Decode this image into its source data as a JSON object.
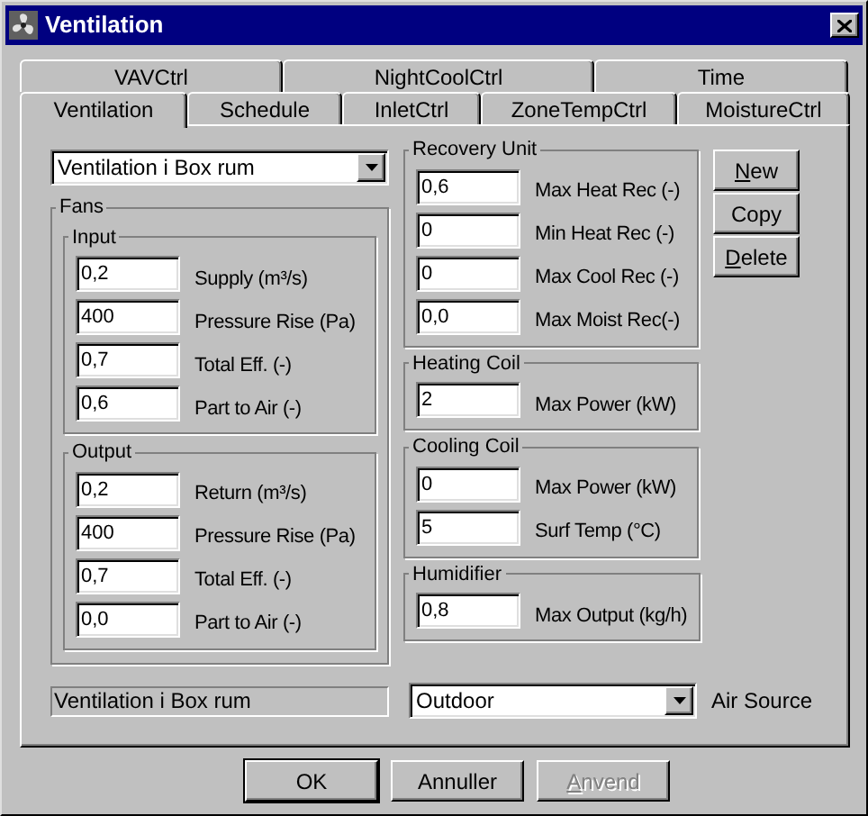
{
  "window": {
    "title": "Ventilation"
  },
  "tab_rows": [
    {
      "tabs": [
        {
          "label": "VAVCtrl",
          "selected": false
        },
        {
          "label": "NightCoolCtrl",
          "selected": false
        },
        {
          "label": "Time",
          "selected": false
        }
      ]
    },
    {
      "tabs": [
        {
          "label": "Ventilation",
          "selected": true
        },
        {
          "label": "Schedule",
          "selected": false
        },
        {
          "label": "InletCtrl",
          "selected": false
        },
        {
          "label": "ZoneTempCtrl",
          "selected": false
        },
        {
          "label": "MoistureCtrl",
          "selected": false
        }
      ]
    }
  ],
  "profile_select": {
    "value": "Ventilation i Box rum"
  },
  "fans": {
    "title": "Fans",
    "groups": [
      {
        "title": "Input",
        "fields": [
          {
            "value": "0,2",
            "label": "Supply (m³/s)"
          },
          {
            "value": "400",
            "label": "Pressure Rise (Pa)"
          },
          {
            "value": "0,7",
            "label": "Total Eff. (-)"
          },
          {
            "value": "0,6",
            "label": "Part to Air (-)"
          }
        ]
      },
      {
        "title": "Output",
        "fields": [
          {
            "value": "0,2",
            "label": "Return (m³/s)"
          },
          {
            "value": "400",
            "label": "Pressure Rise (Pa)"
          },
          {
            "value": "0,7",
            "label": "Total Eff. (-)"
          },
          {
            "value": "0,0",
            "label": "Part to Air (-)"
          }
        ]
      }
    ]
  },
  "right_groups": [
    {
      "title": "Recovery Unit",
      "fields": [
        {
          "value": "0,6",
          "label": "Max Heat Rec (-)"
        },
        {
          "value": "0",
          "label": "Min Heat Rec (-)"
        },
        {
          "value": "0",
          "label": "Max Cool Rec (-)"
        },
        {
          "value": "0,0",
          "label": "Max Moist Rec(-)"
        }
      ]
    },
    {
      "title": "Heating Coil",
      "fields": [
        {
          "value": "2",
          "label": "Max Power (kW)"
        }
      ]
    },
    {
      "title": "Cooling Coil",
      "fields": [
        {
          "value": "0",
          "label": "Max Power (kW)"
        },
        {
          "value": "5",
          "label": "Surf Temp (°C)"
        }
      ]
    },
    {
      "title": "Humidifier",
      "fields": [
        {
          "value": "0,8",
          "label": "Max Output (kg/h)"
        }
      ]
    }
  ],
  "side_buttons": [
    {
      "label": "New",
      "underline_first": true
    },
    {
      "label": "Copy",
      "underline_first": false
    },
    {
      "label": "Delete",
      "underline_first": true
    }
  ],
  "name_display": {
    "value": "Ventilation i Box rum"
  },
  "air_source": {
    "value": "Outdoor",
    "label": "Air Source"
  },
  "dialog_buttons": [
    {
      "label": "OK",
      "disabled": false,
      "underline_first": false
    },
    {
      "label": "Annuller",
      "disabled": false,
      "underline_first": false
    },
    {
      "label": "Anvend",
      "disabled": true,
      "underline_first": true
    }
  ]
}
